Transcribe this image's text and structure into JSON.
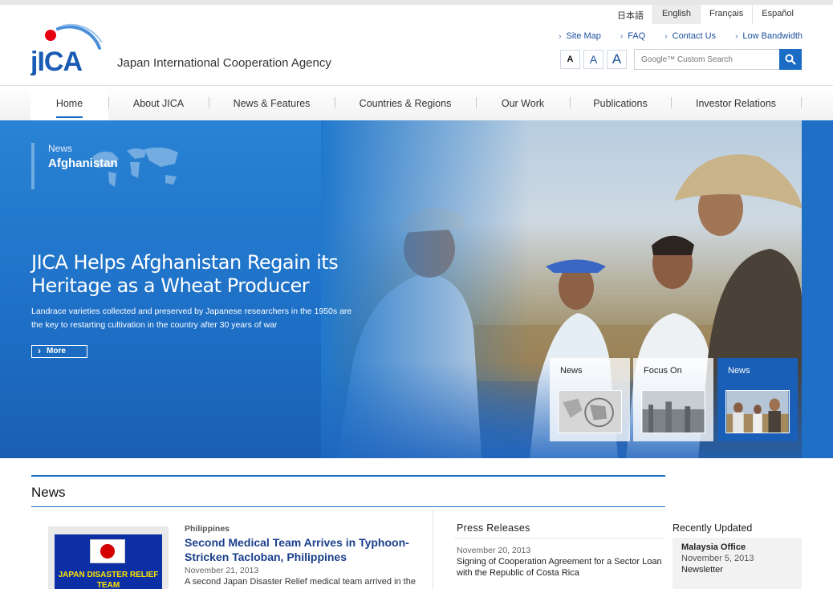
{
  "languages": [
    {
      "label": "日本語",
      "active": false
    },
    {
      "label": "English",
      "active": true
    },
    {
      "label": "Français",
      "active": false
    },
    {
      "label": "Español",
      "active": false
    }
  ],
  "utility_links": [
    "Site Map",
    "FAQ",
    "Contact Us",
    "Low Bandwidth"
  ],
  "font_size_buttons": [
    "A",
    "A",
    "A"
  ],
  "search": {
    "placeholder": "Google™ Custom Search"
  },
  "header": {
    "agency_name": "Japan International Cooperation Agency"
  },
  "nav": [
    "Home",
    "About JICA",
    "News & Features",
    "Countries & Regions",
    "Our Work",
    "Publications",
    "Investor Relations"
  ],
  "hero": {
    "category": "News",
    "location": "Afghanistan",
    "title": "JICA Helps Afghanistan Regain its Heritage as a Wheat Producer",
    "description": "Landrace varieties collected and preserved by Japanese researchers in the 1950s are the key to restarting cultivation in the country after 30 years of war",
    "more_label": "More",
    "cards": [
      {
        "label": "News",
        "active": false
      },
      {
        "label": "Focus On",
        "active": false
      },
      {
        "label": "News",
        "active": true
      }
    ]
  },
  "news": {
    "heading": "News",
    "feature": {
      "image_text": "JAPAN DISASTER RELIEF TEAM",
      "country": "Philippines",
      "title": "Second Medical Team Arrives in Typhoon-Stricken Tacloban, Philippines",
      "date": "November 21, 2013",
      "description": "A second Japan Disaster Relief medical team arrived in the"
    }
  },
  "press_releases": {
    "heading": "Press Releases",
    "items": [
      {
        "date": "November 20, 2013",
        "title": "Signing of Cooperation Agreement for a Sector Loan with the Republic of Costa Rica"
      }
    ]
  },
  "recently_updated": {
    "heading": "Recently Updated",
    "items": [
      {
        "office": "Malaysia Office",
        "date": "November 5, 2013",
        "type": "Newsletter"
      }
    ]
  },
  "colors": {
    "brand_blue": "#1a6cc4",
    "logo_red": "#e60012",
    "link_blue": "#1a4f9c"
  }
}
